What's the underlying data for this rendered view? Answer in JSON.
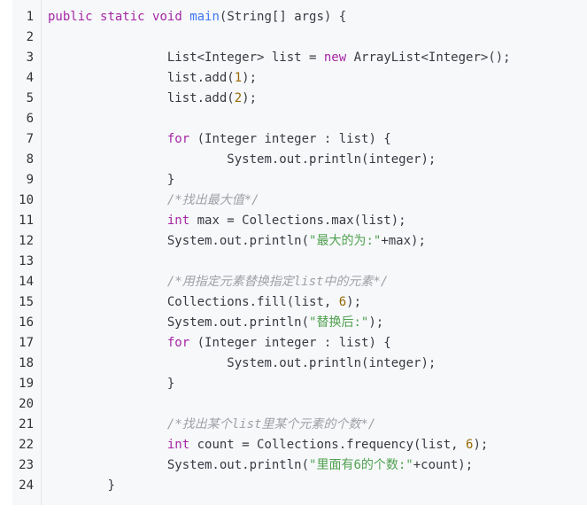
{
  "code": {
    "line_numbers": [
      "1",
      "2",
      "3",
      "4",
      "5",
      "6",
      "7",
      "8",
      "9",
      "10",
      "11",
      "12",
      "13",
      "14",
      "15",
      "16",
      "17",
      "18",
      "19",
      "20",
      "21",
      "22",
      "23",
      "24"
    ],
    "lines": [
      {
        "indent": "",
        "tokens": [
          {
            "t": "kw",
            "v": "public"
          },
          {
            "t": "pl",
            "v": " "
          },
          {
            "t": "kw",
            "v": "static"
          },
          {
            "t": "pl",
            "v": " "
          },
          {
            "t": "kw",
            "v": "void"
          },
          {
            "t": "pl",
            "v": " "
          },
          {
            "t": "fn",
            "v": "main"
          },
          {
            "t": "pl",
            "v": "(String[] args) {"
          }
        ]
      },
      {
        "indent": "",
        "tokens": []
      },
      {
        "indent": "                ",
        "tokens": [
          {
            "t": "pl",
            "v": "List<Integer> list = "
          },
          {
            "t": "kw",
            "v": "new"
          },
          {
            "t": "pl",
            "v": " ArrayList<Integer>();"
          }
        ]
      },
      {
        "indent": "                ",
        "tokens": [
          {
            "t": "pl",
            "v": "list.add("
          },
          {
            "t": "num",
            "v": "1"
          },
          {
            "t": "pl",
            "v": ");"
          }
        ]
      },
      {
        "indent": "                ",
        "tokens": [
          {
            "t": "pl",
            "v": "list.add("
          },
          {
            "t": "num",
            "v": "2"
          },
          {
            "t": "pl",
            "v": ");"
          }
        ]
      },
      {
        "indent": "",
        "tokens": []
      },
      {
        "indent": "                ",
        "tokens": [
          {
            "t": "kw",
            "v": "for"
          },
          {
            "t": "pl",
            "v": " (Integer integer : list) {"
          }
        ]
      },
      {
        "indent": "                        ",
        "tokens": [
          {
            "t": "pl",
            "v": "System.out.println(integer);"
          }
        ]
      },
      {
        "indent": "                ",
        "tokens": [
          {
            "t": "pl",
            "v": "}"
          }
        ]
      },
      {
        "indent": "                ",
        "tokens": [
          {
            "t": "cm",
            "v": "/*找出最大值*/"
          }
        ]
      },
      {
        "indent": "                ",
        "tokens": [
          {
            "t": "kw",
            "v": "int"
          },
          {
            "t": "pl",
            "v": " max = Collections.max(list);"
          }
        ]
      },
      {
        "indent": "                ",
        "tokens": [
          {
            "t": "pl",
            "v": "System.out.println("
          },
          {
            "t": "str",
            "v": "\"最大的为:\""
          },
          {
            "t": "pl",
            "v": "+max);"
          }
        ]
      },
      {
        "indent": "",
        "tokens": []
      },
      {
        "indent": "                ",
        "tokens": [
          {
            "t": "cm",
            "v": "/*用指定元素替换指定list中的元素*/"
          }
        ]
      },
      {
        "indent": "                ",
        "tokens": [
          {
            "t": "pl",
            "v": "Collections.fill(list, "
          },
          {
            "t": "num",
            "v": "6"
          },
          {
            "t": "pl",
            "v": ");"
          }
        ]
      },
      {
        "indent": "                ",
        "tokens": [
          {
            "t": "pl",
            "v": "System.out.println("
          },
          {
            "t": "str",
            "v": "\"替换后:\""
          },
          {
            "t": "pl",
            "v": ");"
          }
        ]
      },
      {
        "indent": "                ",
        "tokens": [
          {
            "t": "kw",
            "v": "for"
          },
          {
            "t": "pl",
            "v": " (Integer integer : list) {"
          }
        ]
      },
      {
        "indent": "                        ",
        "tokens": [
          {
            "t": "pl",
            "v": "System.out.println(integer);"
          }
        ]
      },
      {
        "indent": "                ",
        "tokens": [
          {
            "t": "pl",
            "v": "}"
          }
        ]
      },
      {
        "indent": "",
        "tokens": []
      },
      {
        "indent": "                ",
        "tokens": [
          {
            "t": "cm",
            "v": "/*找出某个list里某个元素的个数*/"
          }
        ]
      },
      {
        "indent": "                ",
        "tokens": [
          {
            "t": "kw",
            "v": "int"
          },
          {
            "t": "pl",
            "v": " count = Collections.frequency(list, "
          },
          {
            "t": "num",
            "v": "6"
          },
          {
            "t": "pl",
            "v": ");"
          }
        ]
      },
      {
        "indent": "                ",
        "tokens": [
          {
            "t": "pl",
            "v": "System.out.println("
          },
          {
            "t": "str",
            "v": "\"里面有6的个数:\""
          },
          {
            "t": "pl",
            "v": "+count);"
          }
        ]
      },
      {
        "indent": "        ",
        "tokens": [
          {
            "t": "pl",
            "v": "}"
          }
        ]
      }
    ]
  },
  "colors": {
    "background": "#f6f8fa",
    "keyword": "#a626a4",
    "function": "#4078f2",
    "string": "#50a14f",
    "number": "#986801",
    "comment": "#a0a1a7",
    "plain": "#383a42"
  }
}
